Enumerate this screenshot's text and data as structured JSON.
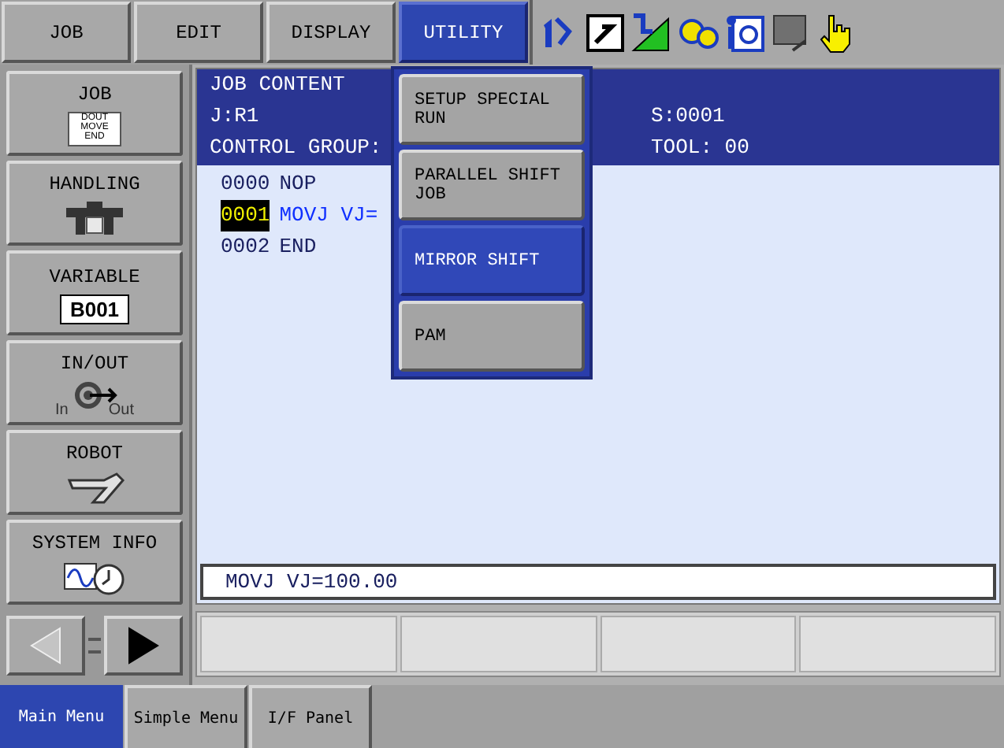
{
  "top_menu": [
    {
      "label": "JOB",
      "selected": false
    },
    {
      "label": "EDIT",
      "selected": false
    },
    {
      "label": "DISPLAY",
      "selected": false
    },
    {
      "label": "UTILITY",
      "selected": true
    }
  ],
  "sidebar": [
    {
      "label": "JOB",
      "kind": "job",
      "icon_text": [
        "DOUT",
        "MOVE",
        "END"
      ]
    },
    {
      "label": "HANDLING",
      "kind": "handling"
    },
    {
      "label": "VARIABLE",
      "kind": "variable",
      "icon_text": [
        "B001"
      ]
    },
    {
      "label": "IN/OUT",
      "kind": "inout",
      "icon_text": [
        "In",
        "Out"
      ]
    },
    {
      "label": "ROBOT",
      "kind": "robot"
    },
    {
      "label": "SYSTEM INFO",
      "kind": "sysinfo"
    }
  ],
  "nav": {
    "back_disabled": true,
    "forward_disabled": false
  },
  "job_content": {
    "title": "JOB CONTENT",
    "job": "J:R1",
    "step": "S:0001",
    "control_group": "CONTROL GROUP:",
    "tool": "TOOL: 00",
    "lines": [
      {
        "number": "0000",
        "instruction": "NOP",
        "selected": false
      },
      {
        "number": "0001",
        "instruction": "MOVJ VJ=",
        "selected": true
      },
      {
        "number": "0002",
        "instruction": "END",
        "selected": false
      }
    ]
  },
  "input_line": {
    "value": "MOVJ VJ=100.00"
  },
  "utility_menu": [
    {
      "label": "SETUP SPECIAL RUN",
      "selected": false
    },
    {
      "label": "PARALLEL SHIFT JOB",
      "selected": false
    },
    {
      "label": "MIRROR SHIFT",
      "selected": true
    },
    {
      "label": "PAM",
      "selected": false
    }
  ],
  "bottom_tabs": [
    {
      "label": "Main Menu",
      "selected": true
    },
    {
      "label": "Simple Menu",
      "selected": false
    },
    {
      "label": "I/F Panel",
      "selected": false
    }
  ]
}
